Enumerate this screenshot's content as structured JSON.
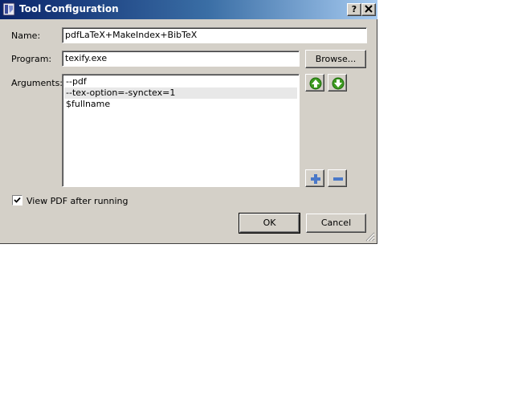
{
  "window": {
    "title": "Tool Configuration",
    "help_label": "?",
    "close_label": "✕"
  },
  "form": {
    "name_label": "Name:",
    "name_value": "pdfLaTeX+MakeIndex+BibTeX",
    "program_label": "Program:",
    "program_value": "texify.exe",
    "browse_label": "Browse...",
    "arguments_label": "Arguments:",
    "arguments": [
      "--pdf",
      "--tex-option=-synctex=1",
      "$fullname"
    ],
    "selected_argument_index": 1,
    "view_pdf_label": "View PDF after running",
    "view_pdf_checked": true
  },
  "list_buttons": {
    "up_icon": "arrow-up-icon",
    "down_icon": "arrow-down-icon",
    "add_icon": "plus-icon",
    "remove_icon": "minus-icon"
  },
  "footer": {
    "ok_label": "OK",
    "cancel_label": "Cancel"
  },
  "colors": {
    "titlebar_start": "#0a246a",
    "titlebar_end": "#a6caf0",
    "dialog_bg": "#d4d0c8",
    "arrow_green": "#3c9a1e",
    "plus_minus_blue": "#4a78c8"
  }
}
